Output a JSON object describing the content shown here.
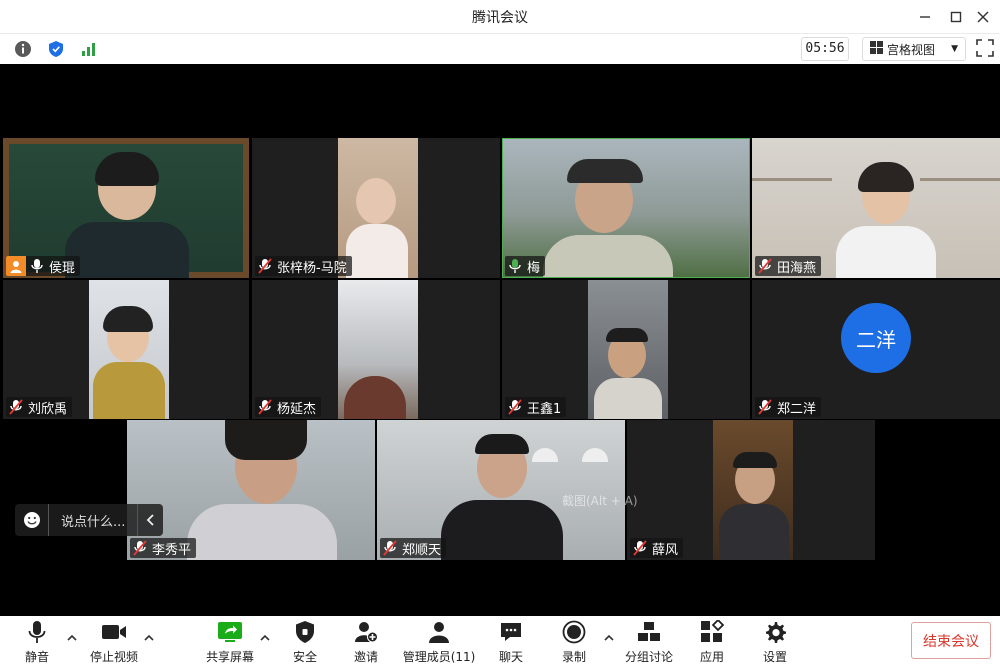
{
  "window": {
    "title": "腾讯会议"
  },
  "infobar": {
    "timer": "05:56",
    "view_label": "宫格视图"
  },
  "participants": [
    {
      "name": "侯琨",
      "host": true
    },
    {
      "name": "张梓杨-马院"
    },
    {
      "name": "梅"
    },
    {
      "name": "田海燕"
    },
    {
      "name": "刘欣禹"
    },
    {
      "name": "杨延杰"
    },
    {
      "name": "王鑫1"
    },
    {
      "name": "郑二洋",
      "avatar_text": "二洋"
    },
    {
      "name": "李秀平"
    },
    {
      "name": "郑顺天"
    },
    {
      "name": "薛风"
    }
  ],
  "chat": {
    "placeholder": "说点什么..."
  },
  "watermark": "截图(Alt + A)",
  "toolbar": {
    "mute": "静音",
    "stop_video": "停止视频",
    "share_screen": "共享屏幕",
    "security": "安全",
    "invite": "邀请",
    "manage_members": "管理成员(11)",
    "chat": "聊天",
    "record": "录制",
    "breakout": "分组讨论",
    "apps": "应用",
    "settings": "设置",
    "end_meeting": "结束会议"
  },
  "colors": {
    "accent": "#1e6fe6",
    "host_badge": "#f28c28",
    "end_red": "#d9372b",
    "active_border": "#4caf50",
    "share_green": "#1aad19"
  }
}
